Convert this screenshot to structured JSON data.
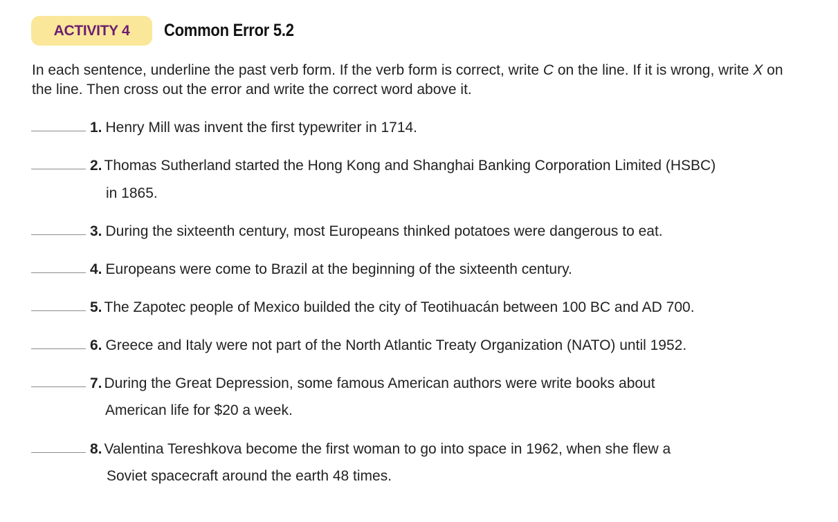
{
  "activity": {
    "badge": "ACTIVITY 4",
    "title": "Common Error 5.2"
  },
  "instructions": {
    "part1": "In each sentence, underline the past verb form. If the verb form is correct, write ",
    "c": "C",
    "part2": " on the line. If it is wrong, write ",
    "x": "X",
    "part3": " on the line. Then cross out the error and write the correct word above it."
  },
  "items": [
    {
      "num": "1.",
      "line1": "Henry Mill was invent the first typewriter in 1714.",
      "line2": ""
    },
    {
      "num": "2.",
      "line1": "Thomas Sutherland started the Hong Kong and Shanghai Banking Corporation Limited (HSBC)",
      "line2": "in 1865."
    },
    {
      "num": "3.",
      "line1": "During the sixteenth century, most Europeans thinked potatoes were dangerous to eat.",
      "line2": ""
    },
    {
      "num": "4.",
      "line1": "Europeans were come to Brazil at the beginning of the sixteenth century.",
      "line2": ""
    },
    {
      "num": "5.",
      "line1": "The Zapotec people of Mexico builded the city of Teotihuacán between 100 BC and AD 700.",
      "line2": ""
    },
    {
      "num": "6.",
      "line1": "Greece and Italy were not part of the North Atlantic Treaty Organization (NATO) until 1952.",
      "line2": ""
    },
    {
      "num": "7.",
      "line1": "During the Great Depression, some famous American authors were write books about",
      "line2": "American life for $20 a week."
    },
    {
      "num": "8.",
      "line1": "Valentina Tereshkova become the first woman to go into space in 1962, when she flew a",
      "line2": "Soviet spacecraft around the earth 48 times."
    }
  ]
}
